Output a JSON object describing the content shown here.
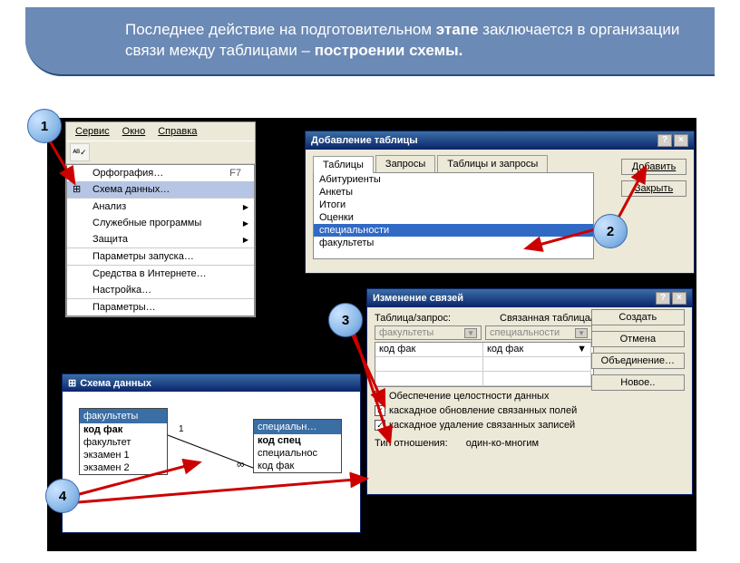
{
  "header": {
    "text_before": "Последнее действие на подготовительном ",
    "text_bold1": "этапе",
    "text_mid": " заключается в организации связи между таблицами – ",
    "text_bold2": "построении схемы."
  },
  "badges": {
    "b1": "1",
    "b2": "2",
    "b3": "3",
    "b4": "4"
  },
  "menu": {
    "bar": {
      "service": "Сервис",
      "window": "Окно",
      "help": "Справка"
    },
    "items": {
      "spelling": "Орфография…",
      "spelling_key": "F7",
      "schema": "Схема данных…",
      "analysis": "Анализ",
      "utilities": "Служебные программы",
      "security": "Защита",
      "startup": "Параметры запуска…",
      "webtools": "Средства в Интернете…",
      "customize": "Настройка…",
      "options": "Параметры…"
    }
  },
  "addTable": {
    "title": "Добавление таблицы",
    "tabs": {
      "tables": "Таблицы",
      "queries": "Запросы",
      "both": "Таблицы и запросы"
    },
    "list": [
      "Абитуриенты",
      "Анкеты",
      "Итоги",
      "Оценки",
      "специальности",
      "факультеты"
    ],
    "selectedIndex": 4,
    "btn_add": "Добавить",
    "btn_close": "Закрыть"
  },
  "editRel": {
    "title": "Изменение связей",
    "lbl_table": "Таблица/запрос:",
    "lbl_linked": "Связанная таблица/запрос:",
    "combo1": "факультеты",
    "combo2": "специальности",
    "field1": "код фак",
    "field2": "код фак",
    "chk_integrity": "Обеспечение целостности данных",
    "chk_cascade_upd": "каскадное обновление связанных полей",
    "chk_cascade_del": "каскадное удаление связанных записей",
    "lbl_type": "Тип отношения:",
    "type_val": "один-ко-многим",
    "btn_create": "Создать",
    "btn_cancel": "Отмена",
    "btn_join": "Объединение…",
    "btn_new": "Новое.."
  },
  "schema": {
    "title": "Схема данных",
    "t1": {
      "name": "факультеты",
      "fields": [
        "код фак",
        "факультет",
        "экзамен 1",
        "экзамен 2"
      ]
    },
    "t2": {
      "name": "специальн…",
      "fields": [
        "код спец",
        "специальнос",
        "код фак"
      ]
    },
    "rel_left": "1",
    "rel_right": "∞"
  }
}
